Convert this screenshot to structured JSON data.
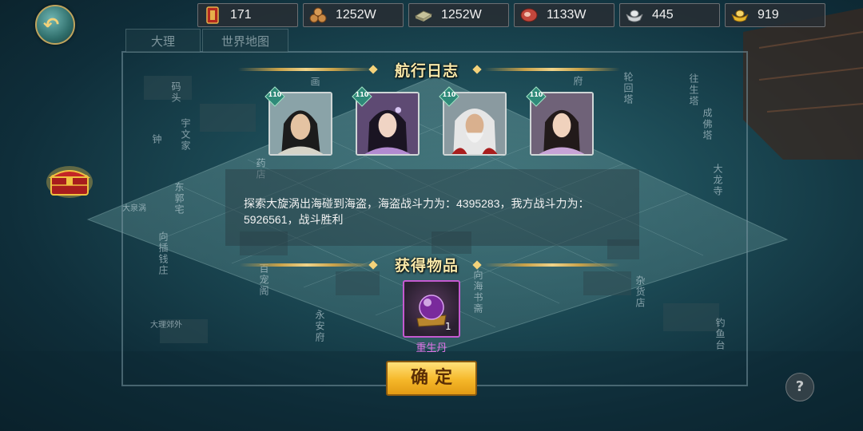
{
  "resources": [
    {
      "name": "token",
      "value": "171",
      "icon": "token-icon",
      "color": "#b3291e"
    },
    {
      "name": "wood",
      "value": "1252W",
      "icon": "wood-icon",
      "color": "#a0652a"
    },
    {
      "name": "stone",
      "value": "1252W",
      "icon": "stone-slab-icon",
      "color": "#9c9a78"
    },
    {
      "name": "meat",
      "value": "1133W",
      "icon": "meat-icon",
      "color": "#b8453a"
    },
    {
      "name": "silver",
      "value": "445",
      "icon": "silver-ingot-icon",
      "color": "#c9cdd0"
    },
    {
      "name": "gold",
      "value": "919",
      "icon": "gold-ingot-icon",
      "color": "#e8b82c"
    }
  ],
  "tabs": [
    {
      "label": "大理"
    },
    {
      "label": "世界地图"
    }
  ],
  "map_labels": [
    "码头",
    "宇文家",
    "钟",
    "东郭宅",
    "大泉涡",
    "向插钱庄",
    "药店",
    "百宠阁",
    "永安府",
    "向海书斋",
    "杂货店",
    "钓鱼台",
    "大龙寺",
    "往生塔",
    "成佛塔",
    "轮回塔",
    "大理郊外",
    "画",
    "府"
  ],
  "voyage_log": {
    "title": "航行日志",
    "heroes": [
      {
        "level": "110",
        "name": "hero-1"
      },
      {
        "level": "110",
        "name": "hero-2"
      },
      {
        "level": "110",
        "name": "hero-3"
      },
      {
        "level": "110",
        "name": "hero-4"
      }
    ],
    "message": "探索大旋涡出海碰到海盗，海盗战斗力为：4395283，我方战斗力为：5926561，战斗胜利"
  },
  "rewards": {
    "title": "获得物品",
    "items": [
      {
        "name": "重生丹",
        "count": "1",
        "icon": "purple-pearl-icon"
      }
    ]
  },
  "confirm_label": "确定",
  "help_label": "?",
  "colors": {
    "title_gold": "#f7e7a8",
    "item_purple": "#c45ad0",
    "button_gold": "#f5b729"
  }
}
